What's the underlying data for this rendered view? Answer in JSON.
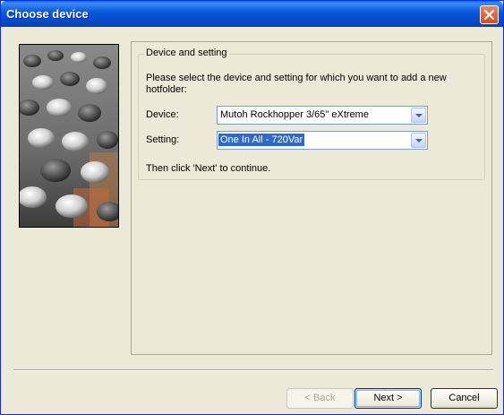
{
  "window": {
    "title": "Choose device"
  },
  "group": {
    "legend": "Device and setting",
    "instruction": "Please select the device and setting for which you want to add a new hotfolder:",
    "hint": "Then click 'Next' to continue."
  },
  "device": {
    "label": "Device:",
    "value": "Mutoh Rockhopper 3/65\" eXtreme"
  },
  "setting": {
    "label": "Setting:",
    "value": "One In All - 720Var"
  },
  "buttons": {
    "back": "< Back",
    "next": "Next >",
    "cancel": "Cancel"
  },
  "icons": {
    "close": "close-icon",
    "dropdown": "chevron-down-icon"
  },
  "colors": {
    "titlebar": "#0a55d6",
    "selection": "#316ac5",
    "close_button": "#d44a21"
  }
}
